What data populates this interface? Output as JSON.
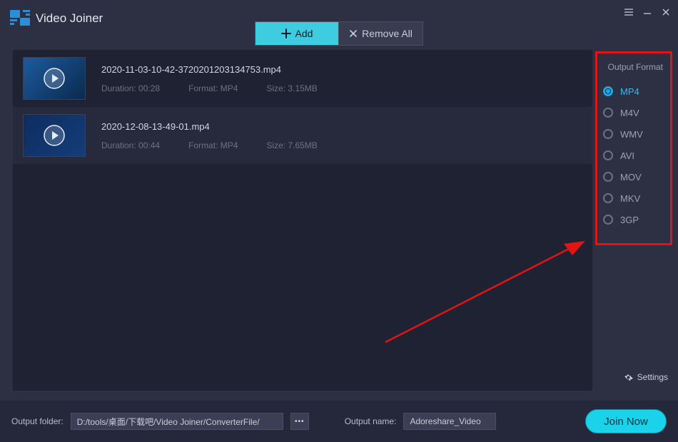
{
  "app": {
    "title": "Video Joiner"
  },
  "toolbar": {
    "add": "Add",
    "removeAll": "Remove All"
  },
  "files": [
    {
      "name": "2020-11-03-10-42-3720201203134753.mp4",
      "duration": "Duration: 00:28",
      "format": "Format: MP4",
      "size": "Size: 3.15MB"
    },
    {
      "name": "2020-12-08-13-49-01.mp4",
      "duration": "Duration: 00:44",
      "format": "Format: MP4",
      "size": "Size: 7.65MB"
    }
  ],
  "side": {
    "title": "Output Format",
    "formats": [
      "MP4",
      "M4V",
      "WMV",
      "AVI",
      "MOV",
      "MKV",
      "3GP"
    ],
    "selected": "MP4",
    "settings": "Settings"
  },
  "bottom": {
    "outFolderLabel": "Output folder:",
    "outFolder": "D:/tools/桌面/下载吧/Video Joiner/ConverterFile/",
    "outNameLabel": "Output name:",
    "outName": "Adoreshare_Video",
    "join": "Join Now"
  }
}
